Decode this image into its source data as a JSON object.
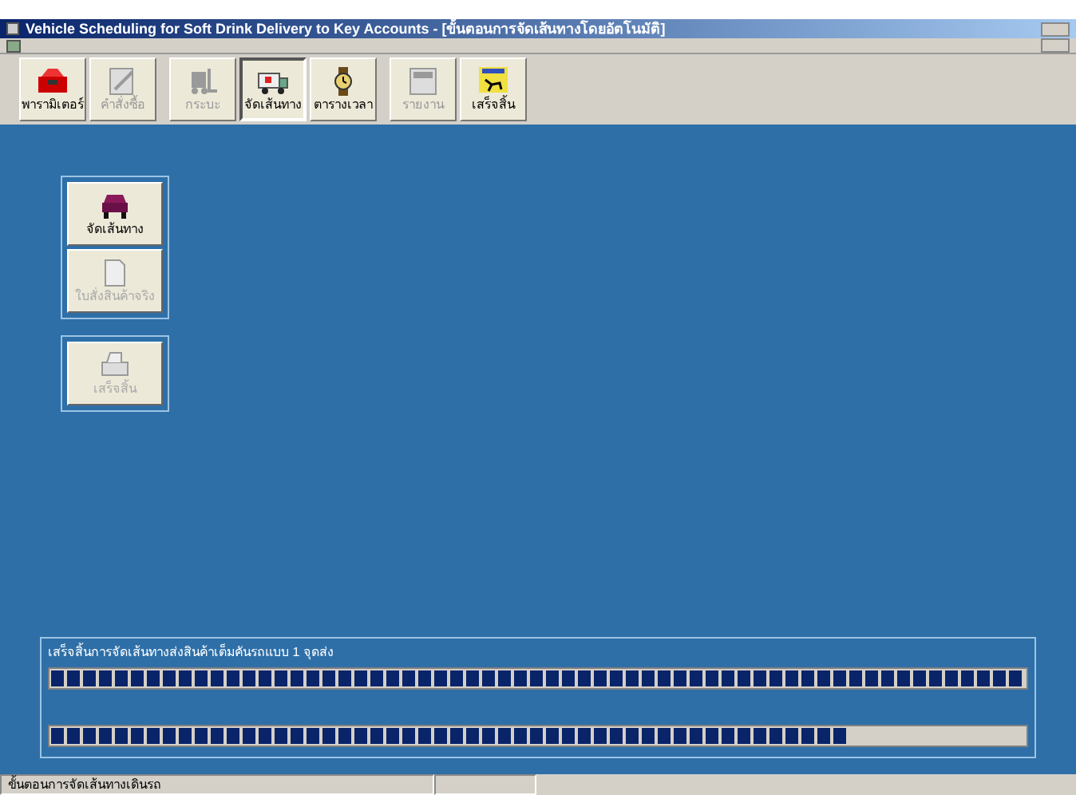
{
  "window": {
    "title": "Vehicle Scheduling for Soft Drink Delivery to Key Accounts - [ขั้นตอนการจัดเส้นทางโดยอัตโนมัติ]"
  },
  "toolbar": [
    {
      "label": "พารามิเตอร์",
      "disabled": false,
      "selected": false
    },
    {
      "label": "คำสั่งซื้อ",
      "disabled": true,
      "selected": false
    },
    {
      "label": "กระบะ",
      "disabled": true,
      "selected": false
    },
    {
      "label": "จัดเส้นทาง",
      "disabled": false,
      "selected": true
    },
    {
      "label": "ตารางเวลา",
      "disabled": false,
      "selected": false
    },
    {
      "label": "รายงาน",
      "disabled": true,
      "selected": false
    },
    {
      "label": "เสร็จสิ้น",
      "disabled": false,
      "selected": false
    }
  ],
  "side_groups": [
    [
      {
        "label": "จัดเส้นทาง",
        "disabled": false
      },
      {
        "label": "ใบสั่งสินค้าจริง",
        "disabled": true
      }
    ],
    [
      {
        "label": "เสร็จสิ้น",
        "disabled": true
      }
    ]
  ],
  "progress": {
    "label": "เสร็จสิ้นการจัดเส้นทางส่งสินค้าเต็มคันรถแบบ 1 จุดส่ง",
    "bars": [
      {
        "level": 1.0
      },
      {
        "level": 0.82
      }
    ]
  },
  "status_bar": "ขั้นตอนการจัดเส้นทางเดินรถ"
}
